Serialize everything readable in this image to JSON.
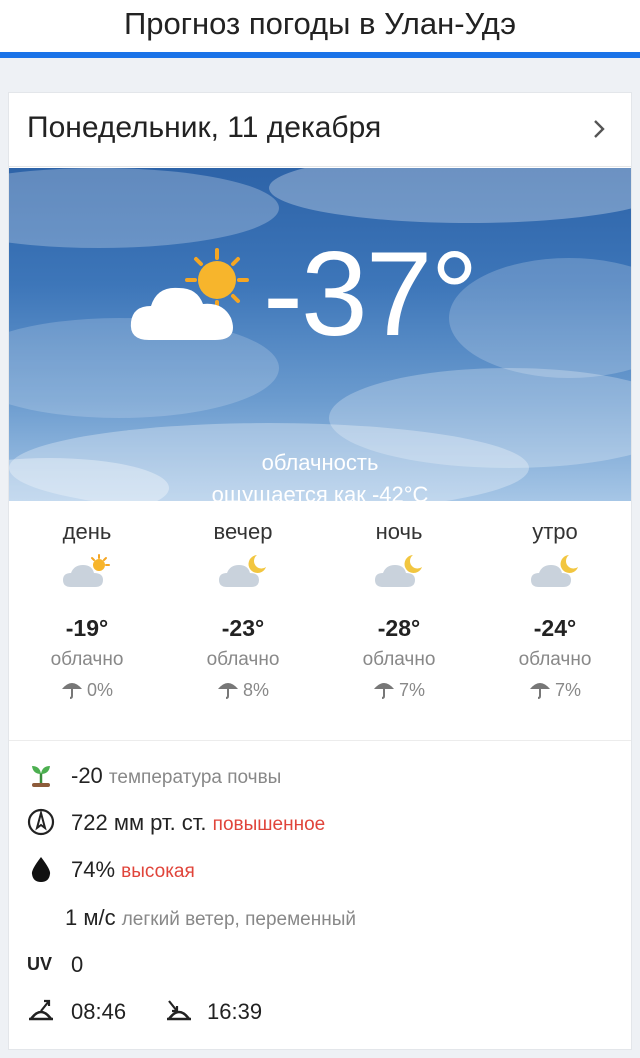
{
  "header": {
    "title": "Прогноз погоды в Улан-Удэ"
  },
  "day": {
    "date_label": "Понедельник, 11 декабря",
    "current": {
      "temperature": "-37°",
      "condition": "облачность",
      "feels_like": "ощущается как -42°C",
      "icon": "partly-cloudy-day-icon"
    },
    "periods": [
      {
        "name": "день",
        "temp": "-19°",
        "condition": "облачно",
        "precip": "0%",
        "icon": "partly-cloudy-day-icon"
      },
      {
        "name": "вечер",
        "temp": "-23°",
        "condition": "облачно",
        "precip": "8%",
        "icon": "partly-cloudy-night-icon"
      },
      {
        "name": "ночь",
        "temp": "-28°",
        "condition": "облачно",
        "precip": "7%",
        "icon": "partly-cloudy-night-icon"
      },
      {
        "name": "утро",
        "temp": "-24°",
        "condition": "облачно",
        "precip": "7%",
        "icon": "partly-cloudy-night-icon"
      }
    ],
    "details": {
      "soil": {
        "value": "-20",
        "label": "температура почвы"
      },
      "pressure": {
        "value": "722 мм рт. ст.",
        "status": "повышенное"
      },
      "humidity": {
        "value": "74%",
        "status": "высокая"
      },
      "wind": {
        "value": "1 м/с",
        "label": "легкий ветер, переменный"
      },
      "uv": {
        "label": "UV",
        "value": "0"
      },
      "sunrise": "08:46",
      "sunset": "16:39"
    }
  },
  "colors": {
    "accent": "#1a73e8",
    "alert": "#e0443a",
    "muted": "#888888"
  }
}
